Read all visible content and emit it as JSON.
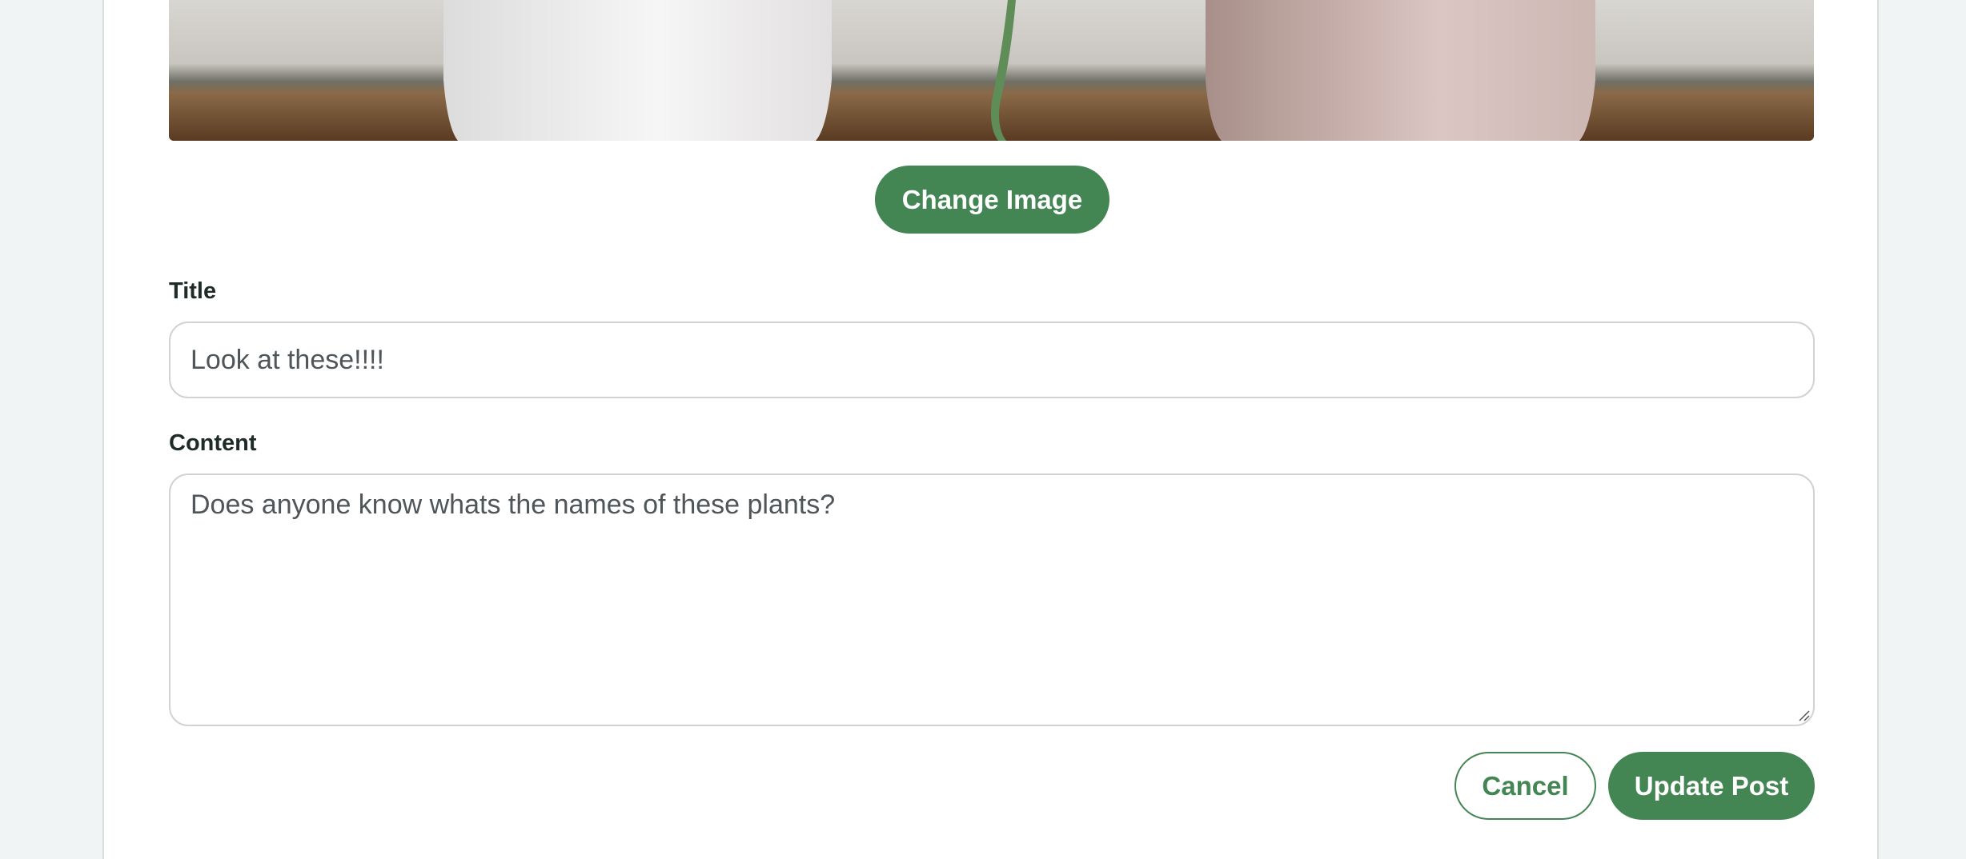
{
  "colors": {
    "accent": "#438553",
    "page_background": "#f1f4f4",
    "card_background": "#ffffff",
    "label_text": "#1f2b26",
    "input_text": "#4f5559",
    "input_border": "#cfd3d3"
  },
  "post_image": {
    "icon": "photo-of-two-plant-pots"
  },
  "buttons": {
    "change_image": "Change Image",
    "cancel": "Cancel",
    "update_post": "Update Post"
  },
  "form": {
    "title_label": "Title",
    "title_value": "Look at these!!!!",
    "content_label": "Content",
    "content_value": "Does anyone know whats the names of these plants?"
  }
}
